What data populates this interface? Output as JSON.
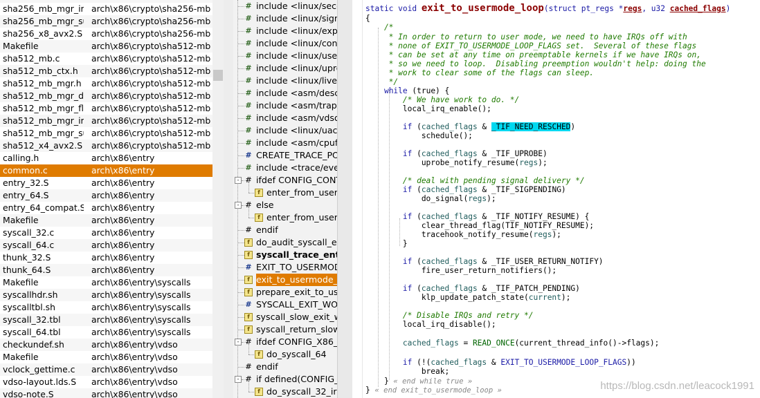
{
  "file_list": [
    {
      "name": "sha256_mb_mgr_init",
      "path": "arch\\x86\\crypto\\sha256-mb"
    },
    {
      "name": "sha256_mb_mgr_sub",
      "path": "arch\\x86\\crypto\\sha256-mb"
    },
    {
      "name": "sha256_x8_avx2.S",
      "path": "arch\\x86\\crypto\\sha256-mb"
    },
    {
      "name": "Makefile",
      "path": "arch\\x86\\crypto\\sha512-mb"
    },
    {
      "name": "sha512_mb.c",
      "path": "arch\\x86\\crypto\\sha512-mb"
    },
    {
      "name": "sha512_mb_ctx.h",
      "path": "arch\\x86\\crypto\\sha512-mb"
    },
    {
      "name": "sha512_mb_mgr.h",
      "path": "arch\\x86\\crypto\\sha512-mb"
    },
    {
      "name": "sha512_mb_mgr_dat",
      "path": "arch\\x86\\crypto\\sha512-mb"
    },
    {
      "name": "sha512_mb_mgr_flus",
      "path": "arch\\x86\\crypto\\sha512-mb"
    },
    {
      "name": "sha512_mb_mgr_init",
      "path": "arch\\x86\\crypto\\sha512-mb"
    },
    {
      "name": "sha512_mb_mgr_sub",
      "path": "arch\\x86\\crypto\\sha512-mb"
    },
    {
      "name": "sha512_x4_avx2.S",
      "path": "arch\\x86\\crypto\\sha512-mb"
    },
    {
      "name": "calling.h",
      "path": "arch\\x86\\entry"
    },
    {
      "name": "common.c",
      "path": "arch\\x86\\entry",
      "selected": true
    },
    {
      "name": "entry_32.S",
      "path": "arch\\x86\\entry"
    },
    {
      "name": "entry_64.S",
      "path": "arch\\x86\\entry"
    },
    {
      "name": "entry_64_compat.S",
      "path": "arch\\x86\\entry"
    },
    {
      "name": "Makefile",
      "path": "arch\\x86\\entry"
    },
    {
      "name": "syscall_32.c",
      "path": "arch\\x86\\entry"
    },
    {
      "name": "syscall_64.c",
      "path": "arch\\x86\\entry"
    },
    {
      "name": "thunk_32.S",
      "path": "arch\\x86\\entry"
    },
    {
      "name": "thunk_64.S",
      "path": "arch\\x86\\entry"
    },
    {
      "name": "Makefile",
      "path": "arch\\x86\\entry\\syscalls"
    },
    {
      "name": "syscallhdr.sh",
      "path": "arch\\x86\\entry\\syscalls"
    },
    {
      "name": "syscalltbl.sh",
      "path": "arch\\x86\\entry\\syscalls"
    },
    {
      "name": "syscall_32.tbl",
      "path": "arch\\x86\\entry\\syscalls"
    },
    {
      "name": "syscall_64.tbl",
      "path": "arch\\x86\\entry\\syscalls"
    },
    {
      "name": "checkundef.sh",
      "path": "arch\\x86\\entry\\vdso"
    },
    {
      "name": "Makefile",
      "path": "arch\\x86\\entry\\vdso"
    },
    {
      "name": "vclock_gettime.c",
      "path": "arch\\x86\\entry\\vdso"
    },
    {
      "name": "vdso-layout.lds.S",
      "path": "arch\\x86\\entry\\vdso"
    },
    {
      "name": "vdso-note.S",
      "path": "arch\\x86\\entry\\vdso"
    }
  ],
  "symbols": [
    {
      "icon": "include",
      "label": "include <linux/secco",
      "depth": 1
    },
    {
      "icon": "include",
      "label": "include <linux/signa",
      "depth": 1
    },
    {
      "icon": "include",
      "label": "include <linux/expor",
      "depth": 1
    },
    {
      "icon": "include",
      "label": "include <linux/conte",
      "depth": 1
    },
    {
      "icon": "include",
      "label": "include <linux/user-",
      "depth": 1
    },
    {
      "icon": "include",
      "label": "include <linux/uprob",
      "depth": 1
    },
    {
      "icon": "include",
      "label": "include <linux/livepa",
      "depth": 1
    },
    {
      "icon": "include",
      "label": "include <asm/desc.h",
      "depth": 1
    },
    {
      "icon": "include",
      "label": "include <asm/traps.",
      "depth": 1
    },
    {
      "icon": "include",
      "label": "include <asm/vdso.h",
      "depth": 1
    },
    {
      "icon": "include",
      "label": "include <linux/uacce",
      "depth": 1
    },
    {
      "icon": "include",
      "label": "include <asm/cpufe",
      "depth": 1
    },
    {
      "icon": "macro",
      "label": "CREATE_TRACE_POI",
      "depth": 1
    },
    {
      "icon": "include",
      "label": "include <trace/event",
      "depth": 1
    },
    {
      "icon": "cond",
      "label": "ifdef CONFIG_CONT",
      "depth": 0,
      "expand": "-"
    },
    {
      "icon": "func",
      "label": "enter_from_user_m",
      "depth": 2
    },
    {
      "icon": "cond",
      "label": "else",
      "depth": 0,
      "expand": "-"
    },
    {
      "icon": "func",
      "label": "enter_from_user_m",
      "depth": 2
    },
    {
      "icon": "cond",
      "label": "endif",
      "depth": 1
    },
    {
      "icon": "func",
      "label": "do_audit_syscall_ent",
      "depth": 1
    },
    {
      "icon": "func",
      "label": "syscall_trace_enter",
      "depth": 1,
      "bold": true
    },
    {
      "icon": "macro",
      "label": "EXIT_TO_USERMOD",
      "depth": 1
    },
    {
      "icon": "func",
      "label": "exit_to_usermode_lo",
      "depth": 1,
      "selected": true
    },
    {
      "icon": "func",
      "label": "prepare_exit_to_user",
      "depth": 1
    },
    {
      "icon": "macro",
      "label": "SYSCALL_EXIT_WOR",
      "depth": 1
    },
    {
      "icon": "func",
      "label": "syscall_slow_exit_wo",
      "depth": 1
    },
    {
      "icon": "func",
      "label": "syscall_return_slowp",
      "depth": 1
    },
    {
      "icon": "cond",
      "label": "ifdef CONFIG_X86_6",
      "depth": 0,
      "expand": "-"
    },
    {
      "icon": "func",
      "label": "do_syscall_64",
      "depth": 2
    },
    {
      "icon": "cond",
      "label": "endif",
      "depth": 1
    },
    {
      "icon": "cond",
      "label": "if defined(CONFIG_X",
      "depth": 0,
      "expand": "-"
    },
    {
      "icon": "func",
      "label": "do_syscall_32_irqs",
      "depth": 2
    }
  ],
  "code_lines": [
    [
      {
        "t": "static void ",
        "c": "kw"
      },
      {
        "t": "exit_to_usermode_loop",
        "c": "fn-decl"
      },
      {
        "t": "(struct pt_regs *",
        "c": "kw"
      },
      {
        "t": "regs",
        "c": "param"
      },
      {
        "t": ", u32 ",
        "c": "kw"
      },
      {
        "t": "cached_flags",
        "c": "param"
      },
      {
        "t": ")",
        "c": "kw"
      }
    ],
    [
      {
        "t": "{",
        "c": ""
      }
    ],
    [
      {
        "t": "    /*",
        "c": "cm"
      }
    ],
    [
      {
        "t": "     * In order to return to user mode, we need to have IRQs off with",
        "c": "cm"
      }
    ],
    [
      {
        "t": "     * none of EXIT_TO_USERMODE_LOOP_FLAGS set.  Several of these flags",
        "c": "cm"
      }
    ],
    [
      {
        "t": "     * can be set at any time on preemptable kernels if we have IRQs on,",
        "c": "cm"
      }
    ],
    [
      {
        "t": "     * so we need to loop.  Disabling preemption wouldn't help: doing the",
        "c": "cm"
      }
    ],
    [
      {
        "t": "     * work to clear some of the flags can sleep.",
        "c": "cm"
      }
    ],
    [
      {
        "t": "     */",
        "c": "cm"
      }
    ],
    [
      {
        "t": "    ",
        "c": ""
      },
      {
        "t": "while",
        "c": "kw"
      },
      {
        "t": " (true) {",
        "c": ""
      }
    ],
    [
      {
        "t": "        /* We have work to do. */",
        "c": "cm"
      }
    ],
    [
      {
        "t": "        local_irq_enable();",
        "c": ""
      }
    ],
    [
      {
        "t": "",
        "c": ""
      }
    ],
    [
      {
        "t": "        ",
        "c": ""
      },
      {
        "t": "if",
        "c": "kw"
      },
      {
        "t": " (",
        "c": ""
      },
      {
        "t": "cached_flags",
        "c": "var"
      },
      {
        "t": " & ",
        "c": ""
      },
      {
        "t": "_TIF_NEED_RESCHED",
        "c": "hl"
      },
      {
        "t": ")",
        "c": ""
      }
    ],
    [
      {
        "t": "            schedule();",
        "c": ""
      }
    ],
    [
      {
        "t": "",
        "c": ""
      }
    ],
    [
      {
        "t": "        ",
        "c": ""
      },
      {
        "t": "if",
        "c": "kw"
      },
      {
        "t": " (",
        "c": ""
      },
      {
        "t": "cached_flags",
        "c": "var"
      },
      {
        "t": " & _TIF_UPROBE)",
        "c": ""
      }
    ],
    [
      {
        "t": "            uprobe_notify_resume(",
        "c": ""
      },
      {
        "t": "regs",
        "c": "var"
      },
      {
        "t": ");",
        "c": ""
      }
    ],
    [
      {
        "t": "",
        "c": ""
      }
    ],
    [
      {
        "t": "        /* deal with pending signal delivery */",
        "c": "cm"
      }
    ],
    [
      {
        "t": "        ",
        "c": ""
      },
      {
        "t": "if",
        "c": "kw"
      },
      {
        "t": " (",
        "c": ""
      },
      {
        "t": "cached_flags",
        "c": "var"
      },
      {
        "t": " & _TIF_SIGPENDING)",
        "c": ""
      }
    ],
    [
      {
        "t": "            do_signal(",
        "c": ""
      },
      {
        "t": "regs",
        "c": "var"
      },
      {
        "t": ");",
        "c": ""
      }
    ],
    [
      {
        "t": "",
        "c": ""
      }
    ],
    [
      {
        "t": "        ",
        "c": ""
      },
      {
        "t": "if",
        "c": "kw"
      },
      {
        "t": " (",
        "c": ""
      },
      {
        "t": "cached_flags",
        "c": "var"
      },
      {
        "t": " & _TIF_NOTIFY_RESUME) {",
        "c": ""
      }
    ],
    [
      {
        "t": "            clear_thread_flag(TIF_NOTIFY_RESUME);",
        "c": ""
      }
    ],
    [
      {
        "t": "            tracehook_notify_resume(",
        "c": ""
      },
      {
        "t": "regs",
        "c": "var"
      },
      {
        "t": ");",
        "c": ""
      }
    ],
    [
      {
        "t": "        }",
        "c": ""
      }
    ],
    [
      {
        "t": "",
        "c": ""
      }
    ],
    [
      {
        "t": "        ",
        "c": ""
      },
      {
        "t": "if",
        "c": "kw"
      },
      {
        "t": " (",
        "c": ""
      },
      {
        "t": "cached_flags",
        "c": "var"
      },
      {
        "t": " & _TIF_USER_RETURN_NOTIFY)",
        "c": ""
      }
    ],
    [
      {
        "t": "            fire_user_return_notifiers();",
        "c": ""
      }
    ],
    [
      {
        "t": "",
        "c": ""
      }
    ],
    [
      {
        "t": "        ",
        "c": ""
      },
      {
        "t": "if",
        "c": "kw"
      },
      {
        "t": " (",
        "c": ""
      },
      {
        "t": "cached_flags",
        "c": "var"
      },
      {
        "t": " & _TIF_PATCH_PENDING)",
        "c": ""
      }
    ],
    [
      {
        "t": "            klp_update_patch_state(",
        "c": ""
      },
      {
        "t": "current",
        "c": "var"
      },
      {
        "t": ");",
        "c": ""
      }
    ],
    [
      {
        "t": "",
        "c": ""
      }
    ],
    [
      {
        "t": "        /* Disable IRQs and retry */",
        "c": "cm"
      }
    ],
    [
      {
        "t": "        local_irq_disable();",
        "c": ""
      }
    ],
    [
      {
        "t": "",
        "c": ""
      }
    ],
    [
      {
        "t": "        ",
        "c": ""
      },
      {
        "t": "cached_flags",
        "c": "var"
      },
      {
        "t": " = ",
        "c": ""
      },
      {
        "t": "READ_ONCE",
        "c": "mac"
      },
      {
        "t": "(current_thread_info()->flags);",
        "c": ""
      }
    ],
    [
      {
        "t": "",
        "c": ""
      }
    ],
    [
      {
        "t": "        ",
        "c": ""
      },
      {
        "t": "if",
        "c": "kw"
      },
      {
        "t": " (!(",
        "c": ""
      },
      {
        "t": "cached_flags",
        "c": "var"
      },
      {
        "t": " & ",
        "c": ""
      },
      {
        "t": "EXIT_TO_USERMODE_LOOP_FLAGS",
        "c": "kw"
      },
      {
        "t": "))",
        "c": ""
      }
    ],
    [
      {
        "t": "            break;",
        "c": ""
      }
    ],
    [
      {
        "t": "    } ",
        "c": ""
      },
      {
        "t": "« end while true »",
        "c": "end-note"
      }
    ],
    [
      {
        "t": "} ",
        "c": ""
      },
      {
        "t": "« end exit_to_usermode_loop »",
        "c": "end-note"
      }
    ]
  ],
  "watermark": "https://blog.csdn.net/leacock1991",
  "colors": {
    "selection": "#df7b00",
    "highlight": "#00d8f0",
    "keyword": "#1a1aa6",
    "comment": "#1f7a00",
    "function_decl": "#8b0000"
  }
}
